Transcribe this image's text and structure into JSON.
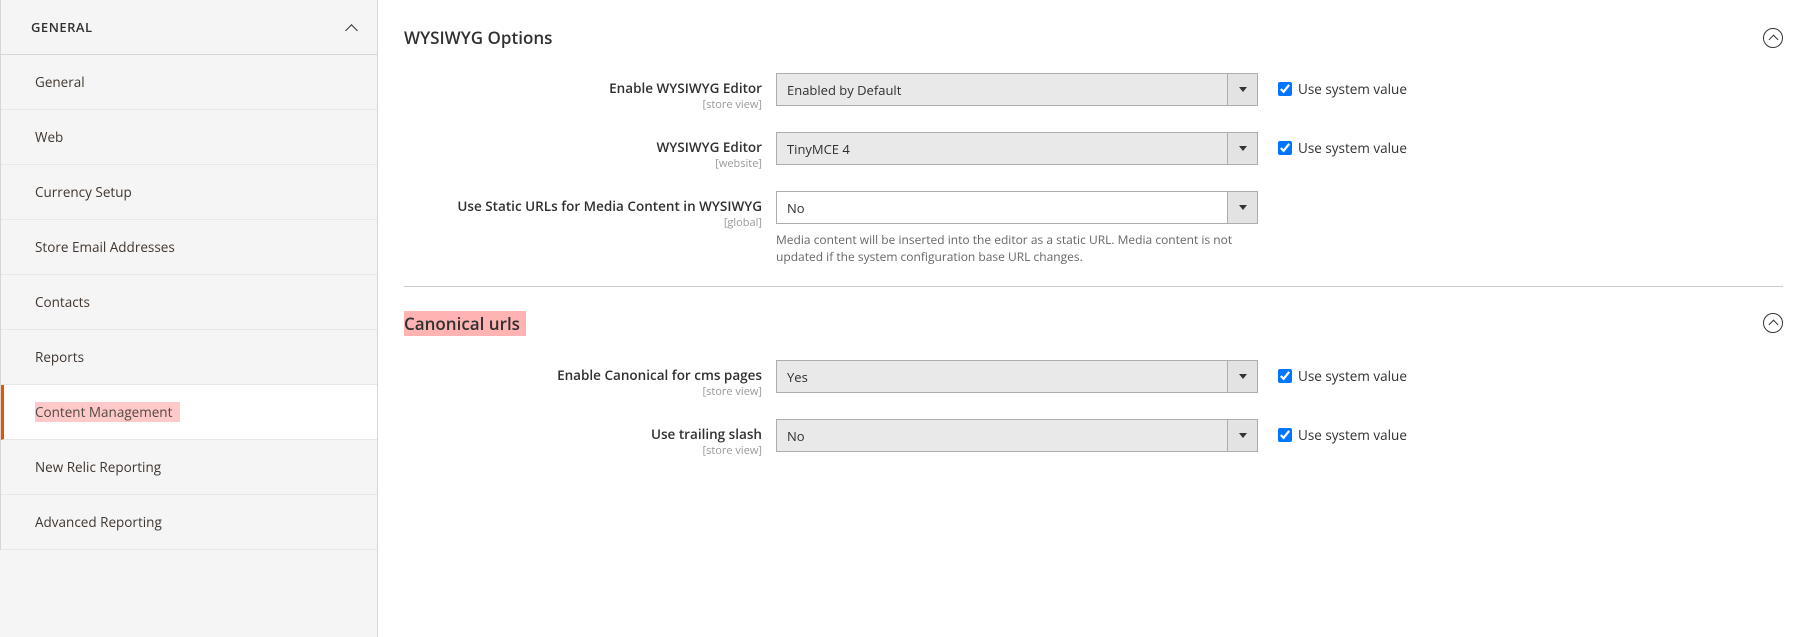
{
  "sidebar": {
    "header": "GENERAL",
    "items": [
      {
        "label": "General",
        "active": false
      },
      {
        "label": "Web",
        "active": false
      },
      {
        "label": "Currency Setup",
        "active": false
      },
      {
        "label": "Store Email Addresses",
        "active": false
      },
      {
        "label": "Contacts",
        "active": false
      },
      {
        "label": "Reports",
        "active": false
      },
      {
        "label": "Content Management",
        "active": true
      },
      {
        "label": "New Relic Reporting",
        "active": false
      },
      {
        "label": "Advanced Reporting",
        "active": false
      }
    ]
  },
  "sections": {
    "wysiwyg": {
      "title": "WYSIWYG Options",
      "fields": {
        "enable": {
          "label": "Enable WYSIWYG Editor",
          "scope": "[store view]",
          "value": "Enabled by Default",
          "sys_label": "Use system value"
        },
        "editor": {
          "label": "WYSIWYG Editor",
          "scope": "[website]",
          "value": "TinyMCE 4",
          "sys_label": "Use system value"
        },
        "static": {
          "label": "Use Static URLs for Media Content in WYSIWYG",
          "scope": "[global]",
          "value": "No",
          "help": "Media content will be inserted into the editor as a static URL. Media content is not updated if the system configuration base URL changes."
        }
      }
    },
    "canonical": {
      "title": "Canonical urls",
      "fields": {
        "enable": {
          "label": "Enable Canonical for cms pages",
          "scope": "[store view]",
          "value": "Yes",
          "sys_label": "Use system value"
        },
        "slash": {
          "label": "Use trailing slash",
          "scope": "[store view]",
          "value": "No",
          "sys_label": "Use system value"
        }
      }
    }
  }
}
